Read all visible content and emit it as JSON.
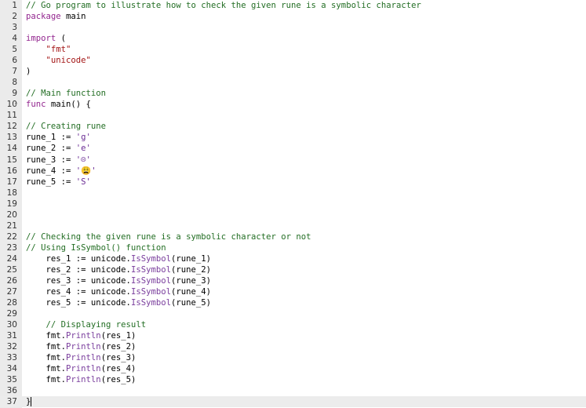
{
  "editor": {
    "lines": [
      {
        "n": "1",
        "text": "// Go program to illustrate how to check the given rune is a symbolic character",
        "kind": "comment"
      },
      {
        "n": "2",
        "text": "package main",
        "kind": "keyword"
      },
      {
        "n": "3",
        "text": "",
        "kind": "plain"
      },
      {
        "n": "4",
        "text": "import (",
        "kind": "keyword"
      },
      {
        "n": "5",
        "text": "    \"fmt\"",
        "kind": "string"
      },
      {
        "n": "6",
        "text": "    \"unicode\"",
        "kind": "string"
      },
      {
        "n": "7",
        "text": ")",
        "kind": "plain"
      },
      {
        "n": "8",
        "text": "",
        "kind": "plain"
      },
      {
        "n": "9",
        "text": "// Main function",
        "kind": "comment"
      },
      {
        "n": "10",
        "text": "func main() {",
        "kind": "keyword",
        "fold": true
      },
      {
        "n": "11",
        "text": "",
        "kind": "plain"
      },
      {
        "n": "12",
        "text": "// Creating rune",
        "kind": "comment"
      },
      {
        "n": "13",
        "text": "rune_1 := 'g'",
        "kind": "plain"
      },
      {
        "n": "14",
        "text": "rune_2 := 'e'",
        "kind": "plain"
      },
      {
        "n": "15",
        "text": "rune_3 := '☹'",
        "kind": "plain"
      },
      {
        "n": "16",
        "text": "rune_4 := '😩'",
        "kind": "plain"
      },
      {
        "n": "17",
        "text": "rune_5 := 'S'",
        "kind": "plain"
      },
      {
        "n": "18",
        "text": "",
        "kind": "plain"
      },
      {
        "n": "19",
        "text": "",
        "kind": "plain"
      },
      {
        "n": "20",
        "text": "",
        "kind": "plain"
      },
      {
        "n": "21",
        "text": "",
        "kind": "plain"
      },
      {
        "n": "22",
        "text": "// Checking the given rune is a symbolic character or not",
        "kind": "comment"
      },
      {
        "n": "23",
        "text": "// Using IsSymbol() function",
        "kind": "comment"
      },
      {
        "n": "24",
        "text": "    res_1 := unicode.IsSymbol(rune_1)",
        "kind": "plain"
      },
      {
        "n": "25",
        "text": "    res_2 := unicode.IsSymbol(rune_2)",
        "kind": "plain"
      },
      {
        "n": "26",
        "text": "    res_3 := unicode.IsSymbol(rune_3)",
        "kind": "plain"
      },
      {
        "n": "27",
        "text": "    res_4 := unicode.IsSymbol(rune_4)",
        "kind": "plain"
      },
      {
        "n": "28",
        "text": "    res_5 := unicode.IsSymbol(rune_5)",
        "kind": "plain"
      },
      {
        "n": "29",
        "text": "",
        "kind": "plain"
      },
      {
        "n": "30",
        "text": "    // Displaying result",
        "kind": "comment"
      },
      {
        "n": "31",
        "text": "    fmt.Println(res_1)",
        "kind": "plain"
      },
      {
        "n": "32",
        "text": "    fmt.Println(res_2)",
        "kind": "plain"
      },
      {
        "n": "33",
        "text": "    fmt.Println(res_3)",
        "kind": "plain"
      },
      {
        "n": "34",
        "text": "    fmt.Println(res_4)",
        "kind": "plain"
      },
      {
        "n": "35",
        "text": "    fmt.Println(res_5)",
        "kind": "plain"
      },
      {
        "n": "36",
        "text": "",
        "kind": "plain"
      },
      {
        "n": "37",
        "text": "}",
        "kind": "plain",
        "active": true
      }
    ]
  }
}
